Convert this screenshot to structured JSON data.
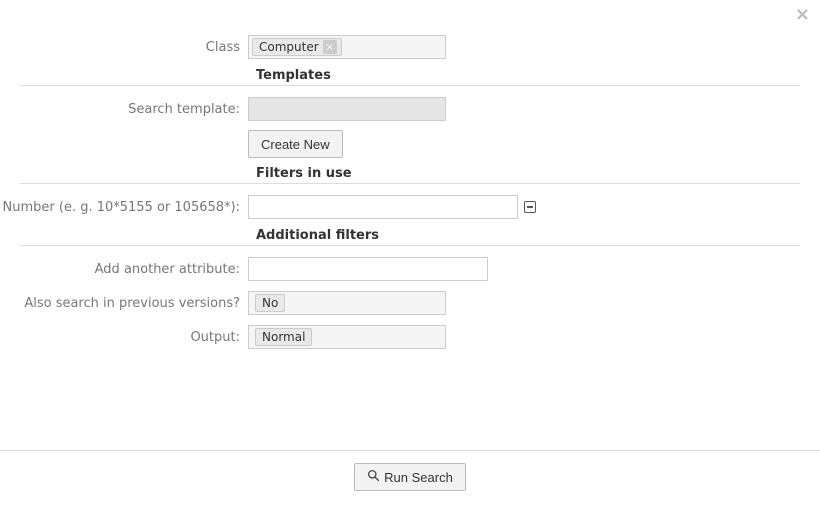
{
  "close_symbol": "×",
  "class_row": {
    "label": "Class",
    "tag": "Computer"
  },
  "sections": {
    "templates": {
      "heading": "Templates",
      "search_template_label": "Search template:",
      "search_template_value": "",
      "create_new_label": "Create New"
    },
    "filters_in_use": {
      "heading": "Filters in use",
      "number_label": "Number (e. g. 10*5155 or 105658*):",
      "number_value": ""
    },
    "additional": {
      "heading": "Additional filters",
      "add_attr_label": "Add another attribute:",
      "add_attr_value": "",
      "prev_versions_label": "Also search in previous versions?",
      "prev_versions_value": "No",
      "output_label": "Output:",
      "output_value": "Normal"
    }
  },
  "footer": {
    "run_search_label": "Run Search"
  }
}
